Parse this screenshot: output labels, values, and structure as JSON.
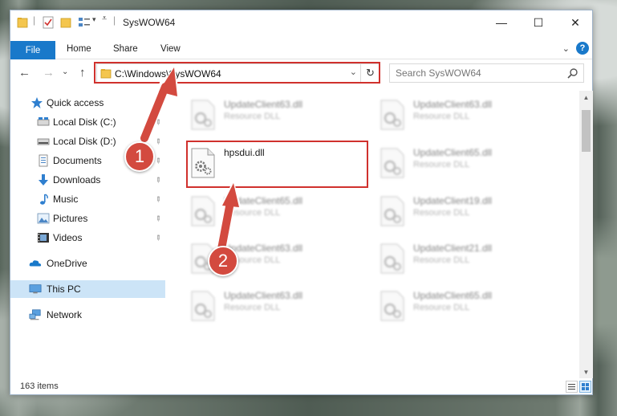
{
  "window": {
    "title": "SysWOW64",
    "minimize": "—",
    "maximize": "☐",
    "close": "✕"
  },
  "ribbon": {
    "file": "File",
    "tabs": [
      "Home",
      "Share",
      "View"
    ],
    "help": "?",
    "expand": "⌄"
  },
  "nav": {
    "back": "←",
    "forward": "→",
    "recent": "⌄",
    "up": "↑",
    "address": "C:\\Windows\\SysWOW64",
    "address_dropdown": "⌄",
    "refresh": "↻"
  },
  "search": {
    "placeholder": "Search SysWOW64"
  },
  "sidebar": {
    "items": [
      {
        "label": "Quick access",
        "icon": "star-icon",
        "pinned": false
      },
      {
        "label": "Local Disk (C:)",
        "icon": "drive-icon",
        "pinned": true
      },
      {
        "label": "Local Disk (D:)",
        "icon": "drive-icon",
        "pinned": true
      },
      {
        "label": "Documents",
        "icon": "documents-icon",
        "pinned": true
      },
      {
        "label": "Downloads",
        "icon": "download-icon",
        "pinned": true
      },
      {
        "label": "Music",
        "icon": "music-icon",
        "pinned": true
      },
      {
        "label": "Pictures",
        "icon": "pictures-icon",
        "pinned": true
      },
      {
        "label": "Videos",
        "icon": "videos-icon",
        "pinned": true
      },
      {
        "label": "OneDrive",
        "icon": "cloud-icon",
        "pinned": false
      },
      {
        "label": "This PC",
        "icon": "computer-icon",
        "pinned": false,
        "selected": true
      },
      {
        "label": "Network",
        "icon": "network-icon",
        "pinned": false
      }
    ],
    "pin_glyph": "📌"
  },
  "files": [
    {
      "name": "UpdateClient63.dll",
      "type": "Resource DLL",
      "blurred": true
    },
    {
      "name": "UpdateClient63.dll",
      "type": "Resource DLL",
      "blurred": true
    },
    {
      "name": "hpsdui.dll",
      "type": "",
      "blurred": false
    },
    {
      "name": "UpdateClient65.dll",
      "type": "Resource DLL",
      "blurred": true
    },
    {
      "name": "UpdateClient65.dll",
      "type": "Resource DLL",
      "blurred": true
    },
    {
      "name": "UpdateClient19.dll",
      "type": "Resource DLL",
      "blurred": true
    },
    {
      "name": "UpdateClient63.dll",
      "type": "Resource DLL",
      "blurred": true
    },
    {
      "name": "UpdateClient21.dll",
      "type": "Resource DLL",
      "blurred": true
    },
    {
      "name": "UpdateClient63.dll",
      "type": "Resource DLL",
      "blurred": true
    },
    {
      "name": "UpdateClient65.dll",
      "type": "Resource DLL",
      "blurred": true
    }
  ],
  "status": {
    "item_count": "163 items"
  },
  "annotations": {
    "step1": "1",
    "step2": "2",
    "highlight_color": "#d0312d",
    "badge_color": "#d34a3f"
  },
  "colors": {
    "accent": "#1979ca",
    "selected_bg": "#cce4f7"
  }
}
